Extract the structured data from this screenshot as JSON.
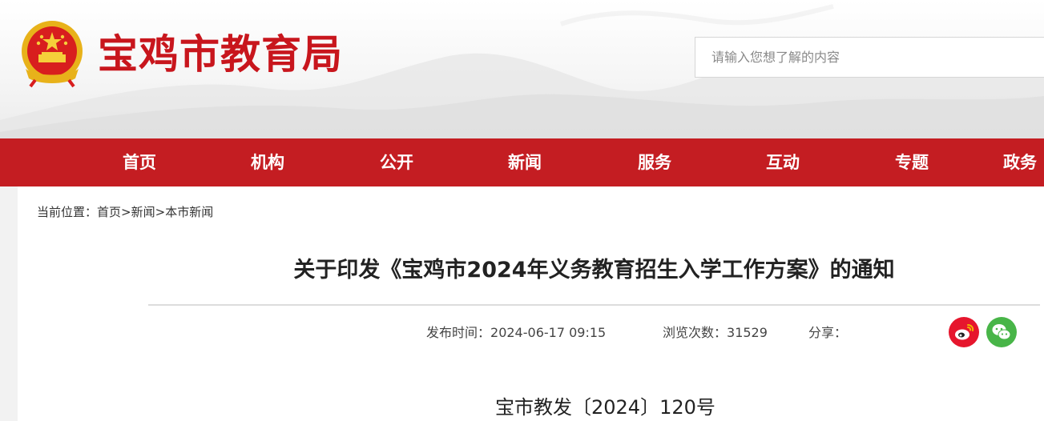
{
  "header": {
    "site_title": "宝鸡市教育局",
    "emblem_icon": "national-emblem-icon",
    "search": {
      "placeholder": "请输入您想了解的内容",
      "value": ""
    }
  },
  "nav": {
    "items": [
      {
        "label": "首页"
      },
      {
        "label": "机构"
      },
      {
        "label": "公开"
      },
      {
        "label": "新闻"
      },
      {
        "label": "服务"
      },
      {
        "label": "互动"
      },
      {
        "label": "专题"
      },
      {
        "label": "政务"
      }
    ]
  },
  "breadcrumb": {
    "prefix": "当前位置：",
    "items": [
      {
        "label": "首页"
      },
      {
        "label": "新闻"
      },
      {
        "label": "本市新闻"
      }
    ],
    "separator": ">"
  },
  "article": {
    "title": "关于印发《宝鸡市2024年义务教育招生入学工作方案》的通知",
    "publish_label": "发布时间：",
    "publish_time": "2024-06-17 09:15",
    "views_label": "浏览次数：",
    "views": "31529",
    "share_label": "分享：",
    "share_icons": [
      "weibo-icon",
      "wechat-icon"
    ],
    "doc_number": "宝市教发〔2024〕120号"
  },
  "colors": {
    "brand_red": "#c8161d",
    "nav_red": "#c41d22",
    "weibo_red": "#e6162d",
    "wechat_green": "#48b548"
  }
}
